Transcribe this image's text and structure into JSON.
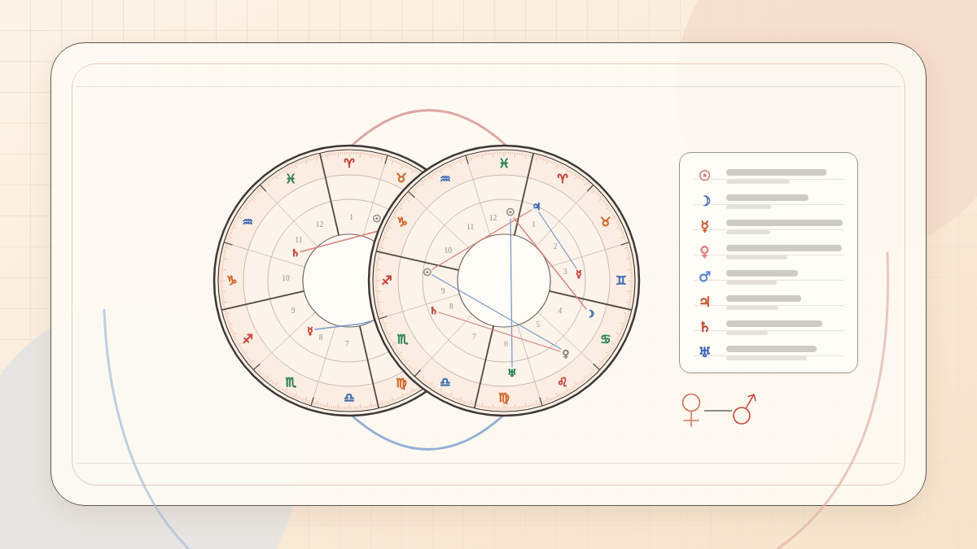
{
  "wheels": [
    {
      "signs": [
        {
          "glyph": "♍",
          "color": "#d0692f"
        },
        {
          "glyph": "♎",
          "color": "#3f6db3"
        },
        {
          "glyph": "♏",
          "color": "#2f8552"
        },
        {
          "glyph": "♐",
          "color": "#c9463f"
        },
        {
          "glyph": "♑",
          "color": "#d0692f"
        },
        {
          "glyph": "♒",
          "color": "#3f6db3"
        },
        {
          "glyph": "♓",
          "color": "#2f8552"
        },
        {
          "glyph": "♈",
          "color": "#c9463f"
        },
        {
          "glyph": "♉",
          "color": "#d0692f"
        }
      ],
      "houses": [
        "7",
        "8",
        "9",
        "10",
        "11",
        "12",
        "1"
      ],
      "planets": [
        {
          "glyph": "♄",
          "color": "#c9463f"
        },
        {
          "glyph": "☉",
          "color": "#8f8782"
        },
        {
          "glyph": "☿",
          "color": "#c9463f"
        }
      ]
    },
    {
      "signs": [
        {
          "glyph": "♓",
          "color": "#2f8552"
        },
        {
          "glyph": "♈",
          "color": "#c9463f"
        },
        {
          "glyph": "♉",
          "color": "#d0692f"
        },
        {
          "glyph": "♊",
          "color": "#3f6db3"
        },
        {
          "glyph": "♋",
          "color": "#2f8552"
        },
        {
          "glyph": "♌",
          "color": "#c9463f"
        },
        {
          "glyph": "♍",
          "color": "#d0692f"
        },
        {
          "glyph": "♎",
          "color": "#3f6db3"
        },
        {
          "glyph": "♏",
          "color": "#2f8552"
        },
        {
          "glyph": "♐",
          "color": "#c9463f"
        },
        {
          "glyph": "♑",
          "color": "#d0692f"
        },
        {
          "glyph": "♒",
          "color": "#3f6db3"
        }
      ],
      "houses": [
        "1",
        "2",
        "3",
        "4",
        "5",
        "6",
        "7",
        "8",
        "9",
        "10",
        "11",
        "12"
      ],
      "planets": [
        {
          "glyph": "♃",
          "color": "#3f6db3"
        },
        {
          "glyph": "☿",
          "color": "#c9463f"
        },
        {
          "glyph": "☽",
          "color": "#3f6db3"
        },
        {
          "glyph": "♀",
          "color": "#8f8782"
        },
        {
          "glyph": "♅",
          "color": "#2f8552"
        },
        {
          "glyph": "♄",
          "color": "#c9463f"
        },
        {
          "glyph": "☉",
          "color": "#8f8782"
        },
        {
          "glyph": "☉",
          "color": "#8f8782"
        }
      ]
    }
  ],
  "legend": {
    "rows": [
      {
        "glyph": "☉",
        "color": "#d4716a"
      },
      {
        "glyph": "☽",
        "color": "#4a74bd"
      },
      {
        "glyph": "☿",
        "color": "#c9552c"
      },
      {
        "glyph": "♀",
        "color": "#df827c"
      },
      {
        "glyph": "♂",
        "color": "#5a88cf"
      },
      {
        "glyph": "♃",
        "color": "#c24f27"
      },
      {
        "glyph": "♄",
        "color": "#c2443b"
      },
      {
        "glyph": "♅",
        "color": "#3b63b3"
      }
    ]
  }
}
